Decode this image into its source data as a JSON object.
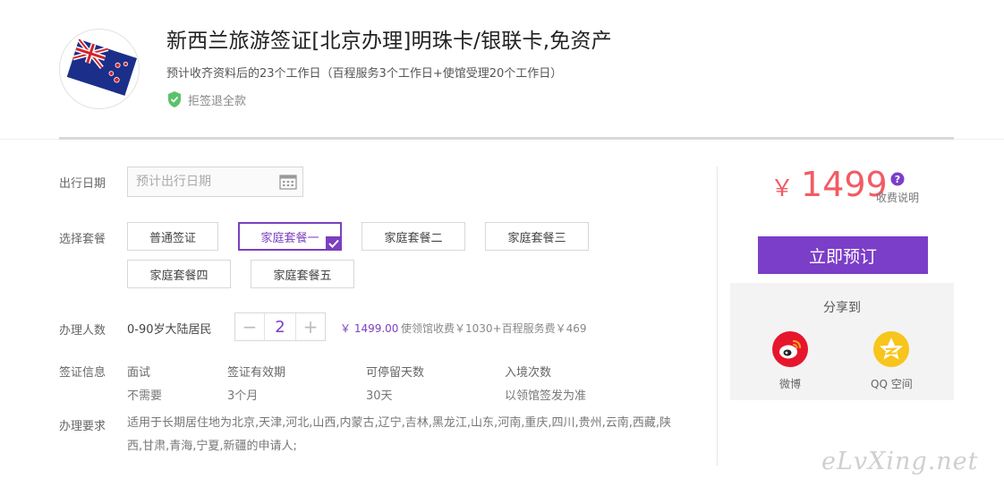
{
  "product": {
    "title": "新西兰旅游签证[北京办理]明珠卡/银联卡,免资产",
    "processing_time": "预计收齐资料后的23个工作日（百程服务3个工作日+使馆受理20个工作日）",
    "refund_badge": "拒签退全款",
    "flag_icon": "new-zealand-flag-icon"
  },
  "form": {
    "date_label": "出行日期",
    "date_placeholder": "预计出行日期",
    "package_label": "选择套餐",
    "packages": [
      {
        "label": "普通签证",
        "selected": false
      },
      {
        "label": "家庭套餐一",
        "selected": true
      },
      {
        "label": "家庭套餐二",
        "selected": false
      },
      {
        "label": "家庭套餐三",
        "selected": false
      },
      {
        "label": "家庭套餐四",
        "selected": false
      },
      {
        "label": "家庭套餐五",
        "selected": false
      }
    ],
    "people_label": "办理人数",
    "people_type": "0-90岁大陆居民",
    "quantity": "2",
    "minus": "−",
    "plus": "+",
    "line_price": "￥ 1499.00",
    "fee_breakdown": "使领馆收费￥1030+百程服务费￥469"
  },
  "visa_info": {
    "label": "签证信息",
    "columns": [
      {
        "header": "面试",
        "value": "不需要"
      },
      {
        "header": "签证有效期",
        "value": "3个月"
      },
      {
        "header": "可停留天数",
        "value": "30天"
      },
      {
        "header": "入境次数",
        "value": "以领馆签发为准"
      }
    ]
  },
  "requirements": {
    "label": "办理要求",
    "text": "适用于长期居住地为北京,天津,河北,山西,内蒙古,辽宁,吉林,黑龙江,山东,河南,重庆,四川,贵州,云南,西藏,陕西,甘肃,青海,宁夏,新疆的申请人;"
  },
  "pricing": {
    "currency": "￥",
    "amount": "1499",
    "fee_note": "收费说明",
    "book_button": "立即预订"
  },
  "share": {
    "title": "分享到",
    "targets": [
      {
        "label": "微博",
        "icon": "weibo-icon"
      },
      {
        "label": "QQ 空间",
        "icon": "qq-zone-icon"
      }
    ]
  },
  "watermark": "eLvXing.net",
  "colors": {
    "accent_purple": "#7b3ec8",
    "price_red": "#f25b63",
    "weibo_red": "#e6162d",
    "qzone_yellow": "#f7c51b",
    "shield_green": "#5bc26b"
  }
}
